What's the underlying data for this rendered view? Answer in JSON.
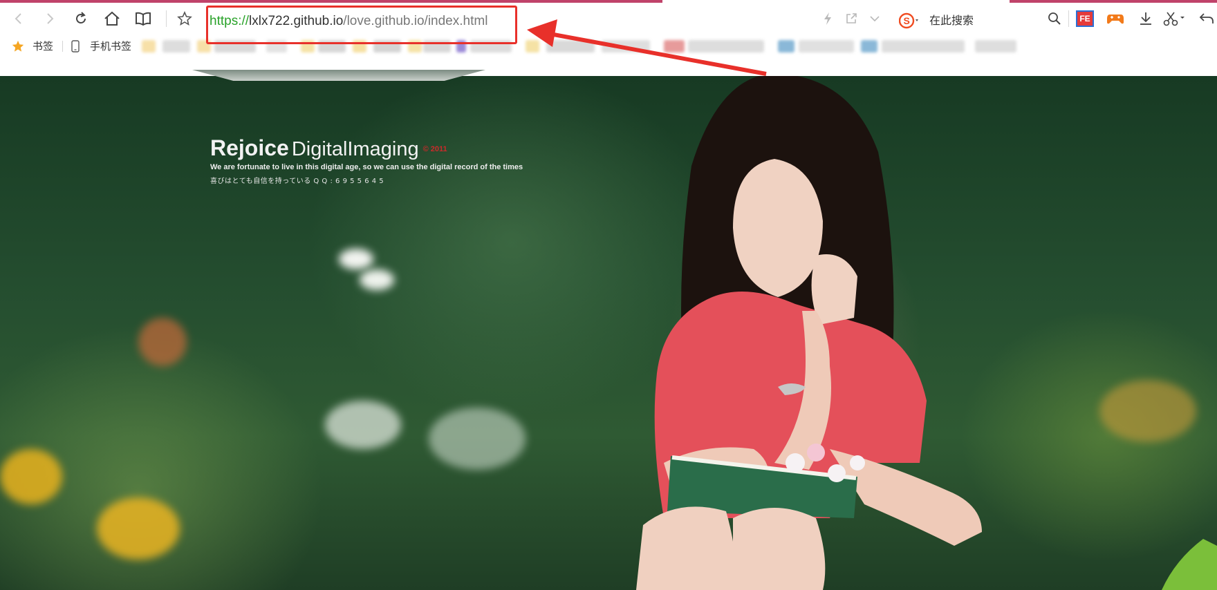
{
  "colors": {
    "accent_strip": "#c0436a",
    "annotation_red": "#e8302a",
    "url_scheme": "#2aa22a"
  },
  "toolbar": {
    "icons": [
      "back-icon",
      "forward-icon",
      "reload-icon",
      "home-icon",
      "reader-icon",
      "favorite-star-icon"
    ],
    "url": {
      "scheme": "https://",
      "host": "lxlx722.github.io",
      "path": "/love.github.io/index.html"
    },
    "right_icons": [
      "lightning-icon",
      "share-icon",
      "chevron-down-icon"
    ],
    "search": {
      "engine_icon": "sogou-icon",
      "placeholder": "在此搜索"
    },
    "extensions": [
      "magnifier-icon",
      "fe-extension-icon",
      "game-icon",
      "download-icon",
      "scissors-icon",
      "undo-icon"
    ],
    "fe_label": "FE"
  },
  "bookmarks": {
    "bookmarks_label": "书签",
    "mobile_label": "手机书签"
  },
  "photo": {
    "brand_bold": "Rejoice",
    "brand_regular": "DigitalImaging",
    "brand_year": "© 2011",
    "tagline": "We are fortunate to live in this digital age,  so we can use the digital record of the times",
    "tagline_jp": "喜びはとても自信を持っている  Q Q : 6 9 5 5 6 4 5"
  }
}
